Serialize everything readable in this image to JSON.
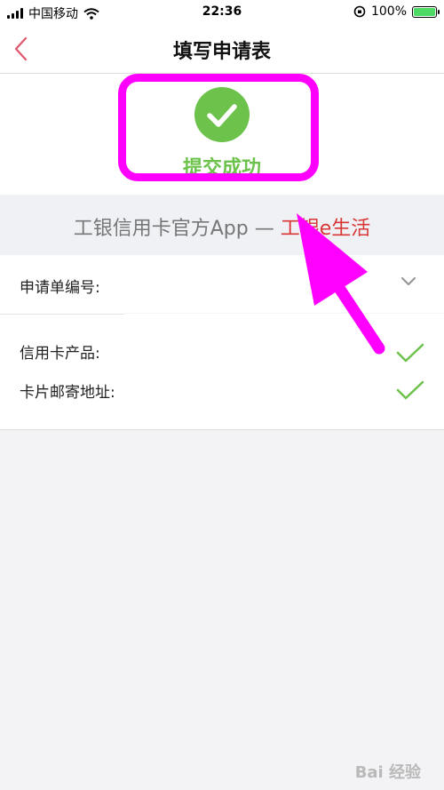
{
  "status_bar": {
    "carrier": "中国移动",
    "time": "22:36",
    "battery": "100%"
  },
  "nav": {
    "title": "填写申请表"
  },
  "success": {
    "message": "提交成功",
    "color": "#6cc24a"
  },
  "banner": {
    "prefix": "工银信用卡官方App —",
    "brand": "工银e生活"
  },
  "form": {
    "application_no_label": "申请单编号:",
    "product_label": "信用卡产品:",
    "address_label": "卡片邮寄地址:"
  },
  "annotation_color": "#ff00ff",
  "watermark": "Bai 经验"
}
